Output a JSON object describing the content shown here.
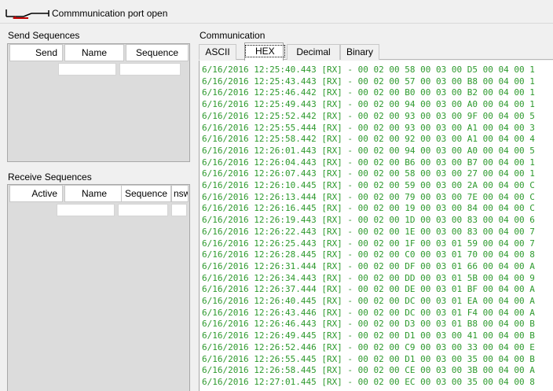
{
  "toolbar": {
    "status": "Commmunication port open",
    "icon": "port-open-icon"
  },
  "send": {
    "label": "Send Sequences",
    "columns": [
      "Send",
      "Name",
      "Sequence"
    ]
  },
  "receive": {
    "label": "Receive Sequences",
    "columns": [
      "Active",
      "Name",
      "Sequence",
      "nsw"
    ]
  },
  "communication": {
    "label": "Communication",
    "tabs": [
      "ASCII",
      "HEX",
      "Decimal",
      "Binary"
    ],
    "active_tab": "HEX"
  },
  "log": [
    "6/16/2016 12:25:40.443 [RX] - 00 02 00 58 00 03 00 D5 00 04 00 1",
    "6/16/2016 12:25:43.443 [RX] - 00 02 00 57 00 03 00 B8 00 04 00 1",
    "6/16/2016 12:25:46.442 [RX] - 00 02 00 B0 00 03 00 B2 00 04 00 1",
    "6/16/2016 12:25:49.443 [RX] - 00 02 00 94 00 03 00 A0 00 04 00 1",
    "6/16/2016 12:25:52.442 [RX] - 00 02 00 93 00 03 00 9F 00 04 00 5",
    "6/16/2016 12:25:55.444 [RX] - 00 02 00 93 00 03 00 A1 00 04 00 3",
    "6/16/2016 12:25:58.442 [RX] - 00 02 00 92 00 03 00 A1 00 04 00 4",
    "6/16/2016 12:26:01.443 [RX] - 00 02 00 94 00 03 00 A0 00 04 00 5",
    "6/16/2016 12:26:04.443 [RX] - 00 02 00 B6 00 03 00 B7 00 04 00 1",
    "6/16/2016 12:26:07.443 [RX] - 00 02 00 58 00 03 00 27 00 04 00 1",
    "6/16/2016 12:26:10.445 [RX] - 00 02 00 59 00 03 00 2A 00 04 00 C",
    "6/16/2016 12:26:13.444 [RX] - 00 02 00 79 00 03 00 7E 00 04 00 C",
    "6/16/2016 12:26:16.445 [RX] - 00 02 00 19 00 03 00 84 00 04 00 C",
    "6/16/2016 12:26:19.443 [RX] - 00 02 00 1D 00 03 00 83 00 04 00 6",
    "6/16/2016 12:26:22.443 [RX] - 00 02 00 1E 00 03 00 83 00 04 00 7",
    "6/16/2016 12:26:25.443 [RX] - 00 02 00 1F 00 03 01 59 00 04 00 7",
    "6/16/2016 12:26:28.445 [RX] - 00 02 00 C0 00 03 01 70 00 04 00 8",
    "6/16/2016 12:26:31.444 [RX] - 00 02 00 DF 00 03 01 66 00 04 00 A",
    "6/16/2016 12:26:34.443 [RX] - 00 02 00 DD 00 03 01 5B 00 04 00 9",
    "6/16/2016 12:26:37.444 [RX] - 00 02 00 DE 00 03 01 BF 00 04 00 A",
    "6/16/2016 12:26:40.445 [RX] - 00 02 00 DC 00 03 01 EA 00 04 00 A",
    "6/16/2016 12:26:43.446 [RX] - 00 02 00 DC 00 03 01 F4 00 04 00 A",
    "6/16/2016 12:26:46.443 [RX] - 00 02 00 D3 00 03 01 B8 00 04 00 B",
    "6/16/2016 12:26:49.445 [RX] - 00 02 00 D1 00 03 00 41 00 04 00 B",
    "6/16/2016 12:26:52.446 [RX] - 00 02 00 C9 00 03 00 33 00 04 00 E",
    "6/16/2016 12:26:55.445 [RX] - 00 02 00 D1 00 03 00 35 00 04 00 B",
    "6/16/2016 12:26:58.445 [RX] - 00 02 00 CE 00 03 00 3B 00 04 00 A",
    "6/16/2016 12:27:01.445 [RX] - 00 02 00 EC 00 03 00 35 00 04 00 8"
  ],
  "colors": {
    "log_text": "#2e9a2e",
    "panel_bg": "#dcdcdc"
  }
}
